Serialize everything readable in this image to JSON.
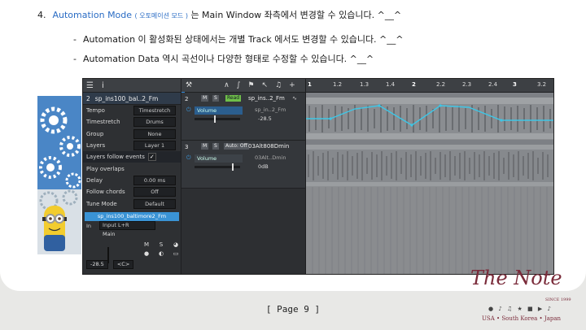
{
  "doc": {
    "line1": {
      "num": "4.",
      "blue_a": "Automation Mode",
      "blue_b": "( 오토메이션 모드 )",
      "rest": "는 Main Window 좌측에서 변경할 수 있습니다. ^__^"
    },
    "bullet1": {
      "dash": "-",
      "text": "Automation 이 활성화된 상태에서는 개별 Track 에서도 변경할 수 있습니다. ^__^"
    },
    "bullet2": {
      "dash": "-",
      "text": "Automation Data 역시 곡선이나 다양한 형태로 수정할 수 있습니다. ^__^"
    },
    "page_label": "[ Page 9 ]"
  },
  "app": {
    "inspector": {
      "title_num": "2",
      "title_name": "sp_ins100_bal..2_Fm",
      "rows": [
        {
          "label": "Tempo",
          "value": "Timestretch"
        },
        {
          "label": "Timestretch",
          "value": "Drums"
        },
        {
          "label": "Group",
          "value": "None"
        },
        {
          "label": "Layers",
          "value": "Layer 1"
        },
        {
          "label": "Layers follow events",
          "value": "✓"
        },
        {
          "label": "Play overlaps",
          "value": ""
        },
        {
          "label": "Delay",
          "value": "0.00 ms"
        },
        {
          "label": "Follow chords",
          "value": "Off"
        },
        {
          "label": "Tune Mode",
          "value": "Default"
        }
      ],
      "channel_name": "sp_ins100_baltimore2_Fm",
      "in_label": "In",
      "in_value": "Input L+R",
      "main_label": "Main",
      "m": "M",
      "s": "S",
      "vol": "-28.5",
      "pan": "<C>"
    },
    "tracks": [
      {
        "num": "2",
        "m": "M",
        "s": "S",
        "mode": "Read",
        "name": "sp_ins..2_Fm",
        "param": "Volume",
        "sub": "sp_in..2_Fm",
        "value": "-28.5"
      },
      {
        "num": "3",
        "m": "M",
        "s": "S",
        "mode": "Auto: Off",
        "name": "03Alt808Dmin",
        "param": "Volume",
        "sub": "03Alt..Dmin",
        "value": "0dB"
      }
    ],
    "ruler": [
      "1",
      "1.2",
      "1.3",
      "1.4",
      "2",
      "2.2",
      "2.3",
      "2.4",
      "3",
      "3.2"
    ]
  },
  "logo": {
    "script": "The Note",
    "since": "SINCE 1999",
    "tagline": "USA • South Korea • Japan"
  },
  "colors": {
    "accent": "#2a6cc4",
    "track_selected": "#2e86d4",
    "automation_line": "#3fc6e6",
    "logo": "#7a2b3a"
  }
}
